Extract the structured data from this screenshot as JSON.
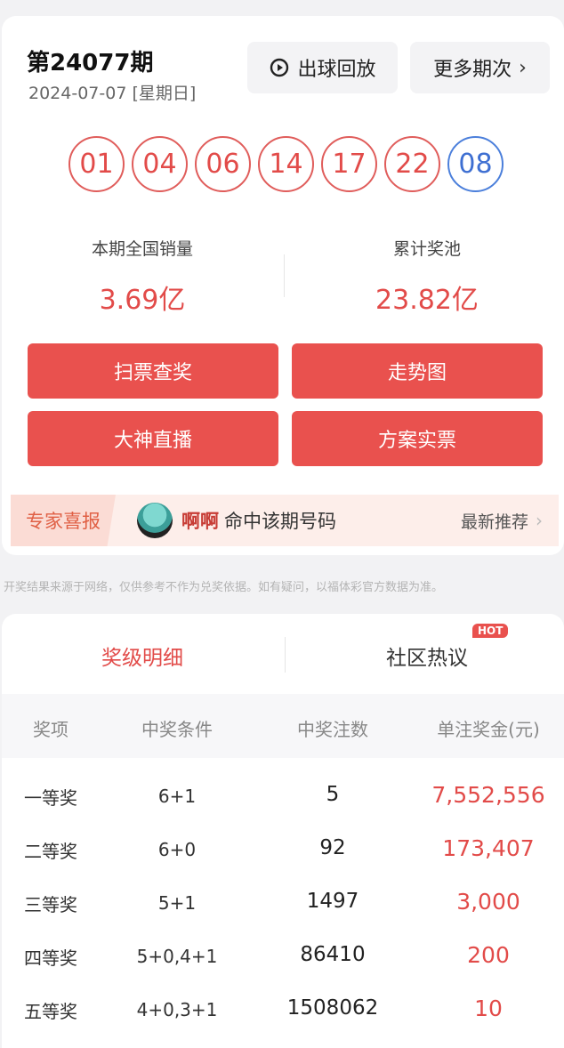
{
  "header": {
    "issue": "第24077期",
    "date": "2024-07-07 [星期日]",
    "replay_label": "出球回放",
    "more_label": "更多期次"
  },
  "balls": {
    "red": [
      "01",
      "04",
      "06",
      "14",
      "17",
      "22"
    ],
    "blue": "08",
    "red_color": "#e24b49",
    "blue_color": "#3e6fd2"
  },
  "stats": {
    "sales_label": "本期全国销量",
    "sales_value": "3.69亿",
    "pool_label": "累计奖池",
    "pool_value": "23.82亿"
  },
  "actions": {
    "scan": "扫票查奖",
    "trend": "走势图",
    "live": "大神直播",
    "plans": "方案实票"
  },
  "expert": {
    "tag": "专家喜报",
    "name": "啊啊",
    "text": "命中该期号码",
    "more": "最新推荐"
  },
  "disclaimer": "开奖结果来源于网络，仅供参考不作为兑奖依据。如有疑问，以福体彩官方数据为准。",
  "tabs": {
    "detail": "奖级明细",
    "community": "社区热议",
    "hot": "HOT"
  },
  "table": {
    "headers": [
      "奖项",
      "中奖条件",
      "中奖注数",
      "单注奖金(元)"
    ],
    "rows": [
      [
        "一等奖",
        "6+1",
        "5",
        "7,552,556"
      ],
      [
        "二等奖",
        "6+0",
        "92",
        "173,407"
      ],
      [
        "三等奖",
        "5+1",
        "1497",
        "3,000"
      ],
      [
        "四等奖",
        "5+0,4+1",
        "86410",
        "200"
      ],
      [
        "五等奖",
        "4+0,3+1",
        "1508062",
        "10"
      ]
    ]
  },
  "colors": {
    "accent": "#e9514e",
    "prize": "#e24b49"
  }
}
